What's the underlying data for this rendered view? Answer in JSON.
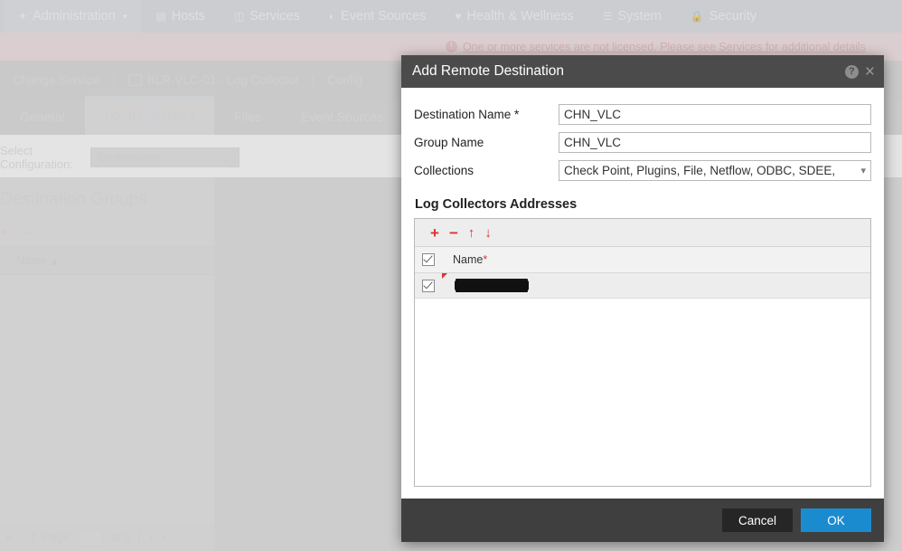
{
  "topnav": {
    "items": [
      {
        "label": "Administration",
        "icon": "compass-icon",
        "caret": "▾",
        "active": true
      },
      {
        "label": "Hosts",
        "icon": "server-icon",
        "caret": "",
        "active": false
      },
      {
        "label": "Services",
        "icon": "stack-icon",
        "caret": "",
        "active": false
      },
      {
        "label": "Event Sources",
        "icon": "rss-icon",
        "caret": "",
        "active": false
      },
      {
        "label": "Health & Wellness",
        "icon": "heart-icon",
        "caret": "",
        "active": false
      },
      {
        "label": "System",
        "icon": "sliders-icon",
        "caret": "",
        "active": false
      },
      {
        "label": "Security",
        "icon": "lock-icon",
        "caret": "",
        "active": false
      }
    ]
  },
  "warning": {
    "icon": "warning-icon",
    "text": "One or more services are not licensed. Please see Services for additional details"
  },
  "breadcrumb": {
    "change_service": "Change Service",
    "separator": "|",
    "host": "BLR-VLC-01 - Log Collector",
    "config": "Config"
  },
  "tabs": [
    {
      "label": "General",
      "active": false
    },
    {
      "label": "Local Collectors",
      "active": true
    },
    {
      "label": "Files",
      "active": false
    },
    {
      "label": "Event Sources",
      "active": false
    }
  ],
  "config_row": {
    "label": "Select Configuration:",
    "select_value": "Destinations",
    "chevron": "⌄"
  },
  "left_panel": {
    "title": "Destination Groups",
    "toolbar": {
      "add": "+",
      "remove": "–"
    },
    "column_header": "Name",
    "sort_caret": "▴",
    "pager": {
      "first": "«",
      "prev": "‹",
      "sep1": "|",
      "page_label": "Page",
      "page_value": "",
      "of_label": "of 0",
      "sep2": "|",
      "next": "›",
      "last": "»"
    }
  },
  "dialog": {
    "title": "Add Remote Destination",
    "help_icon": "?",
    "close_icon": "×",
    "fields": {
      "destination_name": {
        "label": "Destination Name *",
        "value": "CHN_VLC"
      },
      "group_name": {
        "label": "Group Name",
        "value": "CHN_VLC"
      },
      "collections": {
        "label": "Collections",
        "value": "Check Point, Plugins, File, Netflow, ODBC, SDEE,"
      }
    },
    "section_title": "Log Collectors Addresses",
    "list_toolbar": {
      "add": "+",
      "remove": "−",
      "move_up": "↑",
      "move_down": "↓"
    },
    "list_header": {
      "name": "Name",
      "required_mark": "*"
    },
    "rows": [
      {
        "checked": true,
        "name_redacted": true,
        "has_error_mark": true
      }
    ],
    "footer": {
      "cancel": "Cancel",
      "ok": "OK"
    }
  },
  "colors": {
    "accent_blue": "#1b8bd0",
    "toolbar_red": "#e03131",
    "dialog_header": "#4b4b4b",
    "dialog_footer": "#3f3f3f",
    "warning_bg": "#eccfd2"
  }
}
